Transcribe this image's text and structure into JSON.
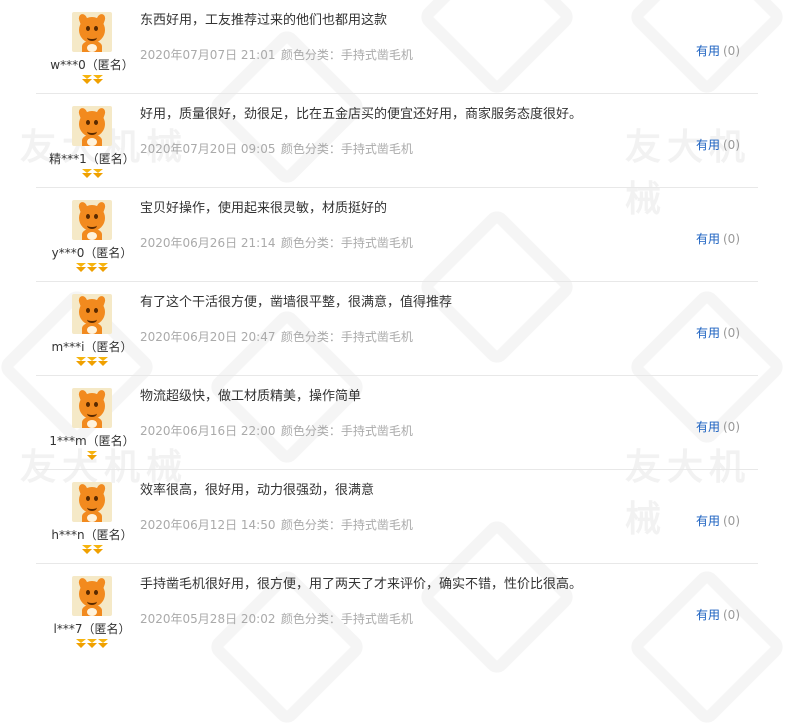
{
  "watermark": "友大机械",
  "reviews": [
    {
      "user": "w***0（匿名）",
      "gems": 2,
      "text": "东西好用，工友推荐过来的他们也都用这款",
      "date": "2020年07月07日 21:01",
      "category": "颜色分类：手持式凿毛机",
      "useful_label": "有用",
      "useful_count": "(0)"
    },
    {
      "user": "精***1（匿名）",
      "gems": 2,
      "text": "好用，质量很好，劲很足，比在五金店买的便宜还好用，商家服务态度很好。",
      "date": "2020年07月20日 09:05",
      "category": "颜色分类：手持式凿毛机",
      "useful_label": "有用",
      "useful_count": "(0)"
    },
    {
      "user": "y***0（匿名）",
      "gems": 3,
      "text": "宝贝好操作，使用起来很灵敏，材质挺好的",
      "date": "2020年06月26日 21:14",
      "category": "颜色分类：手持式凿毛机",
      "useful_label": "有用",
      "useful_count": "(0)"
    },
    {
      "user": "m***i（匿名）",
      "gems": 3,
      "text": "有了这个干活很方便，凿墙很平整，很满意，值得推荐",
      "date": "2020年06月20日 20:47",
      "category": "颜色分类：手持式凿毛机",
      "useful_label": "有用",
      "useful_count": "(0)"
    },
    {
      "user": "1***m（匿名）",
      "gems": 1,
      "text": "物流超级快，做工材质精美，操作简单",
      "date": "2020年06月16日 22:00",
      "category": "颜色分类：手持式凿毛机",
      "useful_label": "有用",
      "useful_count": "(0)"
    },
    {
      "user": "h***n（匿名）",
      "gems": 2,
      "text": "效率很高，很好用，动力很强劲，很满意",
      "date": "2020年06月12日 14:50",
      "category": "颜色分类：手持式凿毛机",
      "useful_label": "有用",
      "useful_count": "(0)"
    },
    {
      "user": "l***7（匿名）",
      "gems": 3,
      "text": "手持凿毛机很好用，很方便，用了两天了才来评价，确实不错，性价比很高。",
      "date": "2020年05月28日 20:02",
      "category": "颜色分类：手持式凿毛机",
      "useful_label": "有用",
      "useful_count": "(0)"
    }
  ]
}
